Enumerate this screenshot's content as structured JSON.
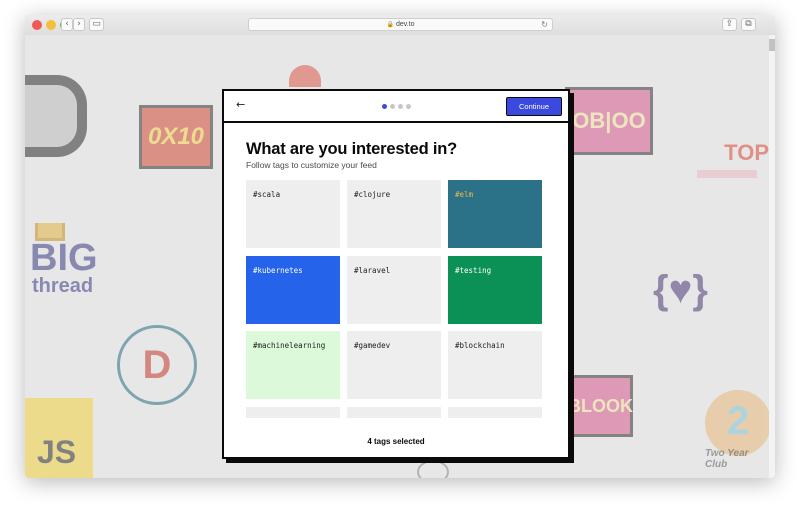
{
  "browser": {
    "url": "dev.to",
    "back_glyph": "‹",
    "forward_glyph": "›",
    "sidebar_glyph": "▭",
    "lock_glyph": "🔒",
    "reload_glyph": "↻",
    "share_glyph": "⇪",
    "tabs_glyph": "⧉"
  },
  "background_stickers": {
    "zero_x_ten": "0X10",
    "ob": "OB|OO",
    "big": "BIG",
    "thread": "thread",
    "top": "TOP",
    "d_badge": "D",
    "js": "JS",
    "bl": "BLOOK",
    "two": "2",
    "two_year": "Two Year Club",
    "heart": "{♥}"
  },
  "modal": {
    "back_glyph": "←",
    "steps": [
      true,
      false,
      false,
      false
    ],
    "continue_label": "Continue",
    "title": "What are you interested in?",
    "subtitle": "Follow tags to customize your feed",
    "selected_text": "4 tags selected"
  },
  "tags": [
    {
      "label": "#scala",
      "selected": false,
      "color": "#eeeeee",
      "text_color": "#222222"
    },
    {
      "label": "#clojure",
      "selected": false,
      "color": "#eeeeee",
      "text_color": "#222222"
    },
    {
      "label": "#elm",
      "selected": true,
      "color": "#2b7187",
      "text_color": "#f0b94d"
    },
    {
      "label": "#kubernetes",
      "selected": true,
      "color": "#2563eb",
      "text_color": "#ffffff"
    },
    {
      "label": "#laravel",
      "selected": false,
      "color": "#eeeeee",
      "text_color": "#222222"
    },
    {
      "label": "#testing",
      "selected": true,
      "color": "#0b9055",
      "text_color": "#ffffff"
    },
    {
      "label": "#machinelearning",
      "selected": true,
      "color": "#dcf9da",
      "text_color": "#222222"
    },
    {
      "label": "#gamedev",
      "selected": false,
      "color": "#eeeeee",
      "text_color": "#222222"
    },
    {
      "label": "#blockchain",
      "selected": false,
      "color": "#eeeeee",
      "text_color": "#222222"
    },
    {
      "label": "",
      "selected": false,
      "color": "#eeeeee",
      "text_color": "#222222"
    },
    {
      "label": "",
      "selected": false,
      "color": "#eeeeee",
      "text_color": "#222222"
    },
    {
      "label": "",
      "selected": false,
      "color": "#eeeeee",
      "text_color": "#222222"
    }
  ],
  "colors": {
    "accent": "#3b49df",
    "modal_border": "#0a0a0a",
    "tag_default": "#eeeeee"
  }
}
